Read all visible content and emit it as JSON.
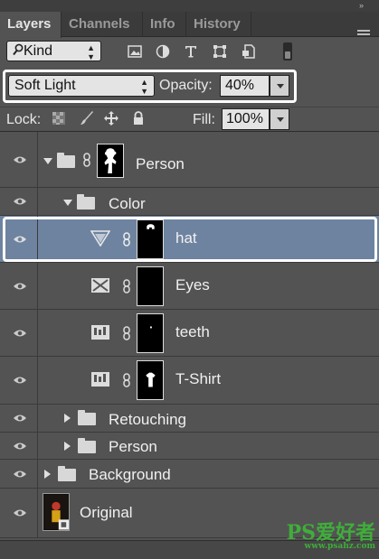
{
  "panel": {
    "collapse_glyph": "»",
    "tabs": [
      {
        "label": "Layers",
        "active": true
      },
      {
        "label": "Channels",
        "active": false
      },
      {
        "label": "Info",
        "active": false
      },
      {
        "label": "History",
        "active": false
      }
    ]
  },
  "filter": {
    "kind_label": "Kind",
    "icons": [
      "pixel-filter-icon",
      "adjustment-filter-icon",
      "type-filter-icon",
      "shape-filter-icon",
      "smart-object-filter-icon"
    ]
  },
  "blend": {
    "mode": "Soft Light",
    "opacity_label": "Opacity:",
    "opacity_value": "40%"
  },
  "lock": {
    "label": "Lock:",
    "fill_label": "Fill:",
    "fill_value": "100%"
  },
  "layers": [
    {
      "name": "Person",
      "type": "group",
      "expanded": true,
      "visible": true
    },
    {
      "name": "Color",
      "type": "group",
      "expanded": true,
      "visible": true
    },
    {
      "name": "hat",
      "type": "adjustment",
      "adjustment": "gradient-map",
      "selected": true,
      "visible": true
    },
    {
      "name": "Eyes",
      "type": "adjustment",
      "adjustment": "channel-mixer",
      "visible": true
    },
    {
      "name": "teeth",
      "type": "adjustment",
      "adjustment": "levels",
      "visible": true
    },
    {
      "name": "T-Shirt",
      "type": "adjustment",
      "adjustment": "levels",
      "visible": true
    },
    {
      "name": "Retouching",
      "type": "group",
      "expanded": false,
      "visible": true
    },
    {
      "name": "Person",
      "type": "group",
      "expanded": false,
      "visible": true
    },
    {
      "name": "Background",
      "type": "group",
      "expanded": false,
      "visible": true
    },
    {
      "name": "Original",
      "type": "smart-object",
      "visible": true
    }
  ],
  "watermark": {
    "text": "PS爱好者",
    "url": "www.psahz.com"
  },
  "colors": {
    "panel_bg": "#535353",
    "selection": "#6e83a0",
    "highlight_border": "#ffffff"
  }
}
